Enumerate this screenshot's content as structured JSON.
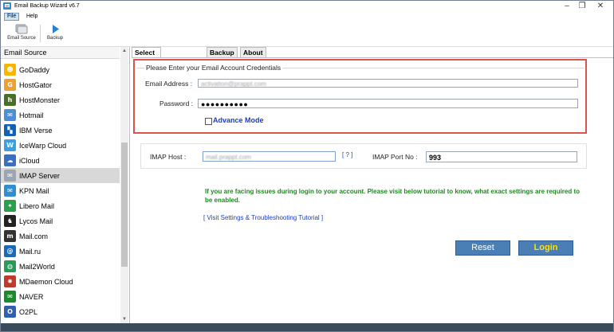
{
  "window": {
    "title": "Email Backup Wizard v6.7",
    "controls": [
      "–",
      "❐",
      "✕"
    ]
  },
  "menu": [
    "File",
    "Help"
  ],
  "toolbar": {
    "email_source": "Email Source",
    "backup": "Backup"
  },
  "sidebar": {
    "heading": "Email Source",
    "items": [
      {
        "label": "GoDaddy",
        "icon": "godaddy-icon",
        "glyph": "☻",
        "color": "#f7b500"
      },
      {
        "label": "HostGator",
        "icon": "hostgator-icon",
        "glyph": "G",
        "color": "#f0a030"
      },
      {
        "label": "HostMonster",
        "icon": "hostmonster-icon",
        "glyph": "h",
        "color": "#4a6f2a"
      },
      {
        "label": "Hotmail",
        "icon": "hotmail-icon",
        "glyph": "✉",
        "color": "#4a8fd8"
      },
      {
        "label": "IBM Verse",
        "icon": "ibm-verse-icon",
        "glyph": "▚",
        "color": "#1261b8"
      },
      {
        "label": "IceWarp Cloud",
        "icon": "icewarp-icon",
        "glyph": "W",
        "color": "#3aa0e0"
      },
      {
        "label": "iCloud",
        "icon": "icloud-icon",
        "glyph": "☁",
        "color": "#3b6fc0"
      },
      {
        "label": "IMAP Server",
        "icon": "imap-server-icon",
        "glyph": "✉",
        "color": "#9aa6b2"
      },
      {
        "label": "KPN Mail",
        "icon": "kpn-mail-icon",
        "glyph": "✉",
        "color": "#2f8fd0"
      },
      {
        "label": "Libero Mail",
        "icon": "libero-mail-icon",
        "glyph": "✦",
        "color": "#2aa04a"
      },
      {
        "label": "Lycos Mail",
        "icon": "lycos-mail-icon",
        "glyph": "♞",
        "color": "#222222"
      },
      {
        "label": "Mail.com",
        "icon": "mail-com-icon",
        "glyph": "m",
        "color": "#333333"
      },
      {
        "label": "Mail.ru",
        "icon": "mail-ru-icon",
        "glyph": "@",
        "color": "#1a6ab8"
      },
      {
        "label": "Mail2World",
        "icon": "mail2world-icon",
        "glyph": "◍",
        "color": "#2a9a5a"
      },
      {
        "label": "MDaemon Cloud",
        "icon": "mdaemon-icon",
        "glyph": "✸",
        "color": "#c0392b"
      },
      {
        "label": "NAVER",
        "icon": "naver-icon",
        "glyph": "✉",
        "color": "#1a8a2a"
      },
      {
        "label": "O2PL",
        "icon": "o2pl-icon",
        "glyph": "O",
        "color": "#3060b0"
      }
    ],
    "selected_index": 7
  },
  "tabs": [
    "Select Email Source",
    "Backup",
    "About"
  ],
  "credentials": {
    "legend": "Please Enter your Email Account Credentials",
    "email_label": "Email Address :",
    "email_value": "activation@prappt.com",
    "password_label": "Password :",
    "password_value": "●●●●●●●●●●",
    "advance_mode": "Advance Mode"
  },
  "imap": {
    "host_label": "IMAP Host :",
    "host_value": "mail.prappt.com",
    "help": "[ ? ]",
    "port_label": "IMAP Port No :",
    "port_value": "993"
  },
  "notice": "If you are facing issues during login to your account. Please visit below tutorial to know, what exact settings are required to be enabled.",
  "tutorial_link": "[ Visit Settings & Troubleshooting Tutorial ]",
  "buttons": {
    "reset": "Reset",
    "login": "Login"
  }
}
